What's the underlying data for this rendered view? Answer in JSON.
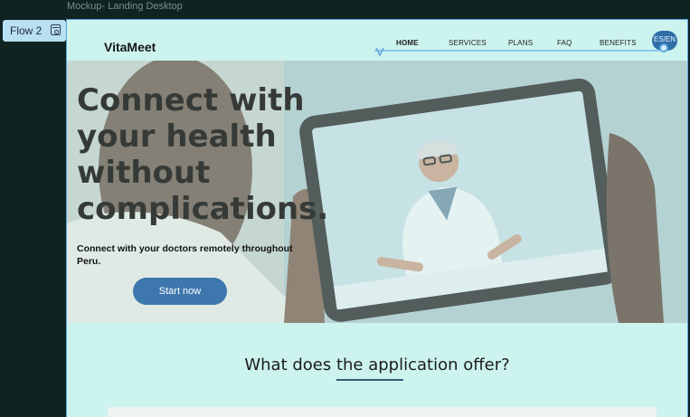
{
  "canvas": {
    "frame_title": "Mockup- Landing Desktop",
    "flow_label": "Flow 2"
  },
  "site": {
    "brand": "VitaMeet",
    "nav": [
      "HOME",
      "SERVICES",
      "PLANS",
      "FAQ",
      "BENEFITS"
    ],
    "lang_toggle": "ES/EN"
  },
  "hero": {
    "title": "Connect with your health without complications.",
    "subtitle": "Connect with your doctors remotely throughout Peru.",
    "cta": "Start now"
  },
  "section": {
    "title": "What does the application offer?"
  },
  "colors": {
    "background": "#cdf3ee",
    "cta": "#3d77ae",
    "flow_chip": "#b9dff2",
    "canvas": "#0f2321"
  }
}
